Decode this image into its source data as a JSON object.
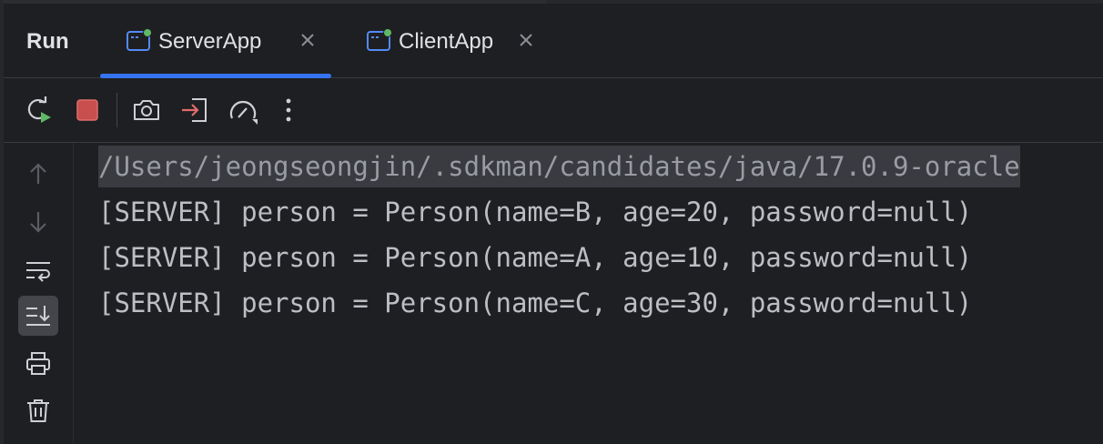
{
  "colors": {
    "background": "#1e1f22",
    "accent": "#3574f0",
    "run_indicator": "#5fb865",
    "stop": "#c94f4f",
    "text": "#bcbec4"
  },
  "run_panel": {
    "title": "Run",
    "tabs": [
      {
        "label": "ServerApp",
        "icon": "app-window-icon",
        "running": true,
        "selected": true,
        "close_icon": "close-icon"
      },
      {
        "label": "ClientApp",
        "icon": "app-window-icon",
        "running": true,
        "selected": false,
        "close_icon": "close-icon"
      }
    ]
  },
  "toolbar": {
    "buttons": [
      {
        "name": "rerun",
        "icon": "rerun-icon"
      },
      {
        "name": "stop",
        "icon": "stop-icon"
      },
      {
        "name": "screenshot",
        "icon": "camera-icon"
      },
      {
        "name": "exit",
        "icon": "exit-icon"
      },
      {
        "name": "profiler",
        "icon": "speedometer-icon"
      },
      {
        "name": "more",
        "icon": "more-vertical-icon"
      }
    ]
  },
  "gutter": {
    "buttons": [
      {
        "name": "up",
        "icon": "arrow-up-icon",
        "enabled": false
      },
      {
        "name": "down",
        "icon": "arrow-down-icon",
        "enabled": false
      },
      {
        "name": "soft-wrap",
        "icon": "soft-wrap-icon",
        "enabled": true
      },
      {
        "name": "scroll-to-end",
        "icon": "scroll-to-end-icon",
        "enabled": true,
        "active": true
      },
      {
        "name": "print",
        "icon": "print-icon",
        "enabled": true
      },
      {
        "name": "clear",
        "icon": "trash-icon",
        "enabled": true
      }
    ]
  },
  "console": {
    "command_line": "/Users/jeongseongjin/.sdkman/candidates/java/17.0.9-oracle",
    "lines": [
      "[SERVER] person = Person(name=B, age=20, password=null)",
      "[SERVER] person = Person(name=A, age=10, password=null)",
      "[SERVER] person = Person(name=C, age=30, password=null)"
    ]
  }
}
